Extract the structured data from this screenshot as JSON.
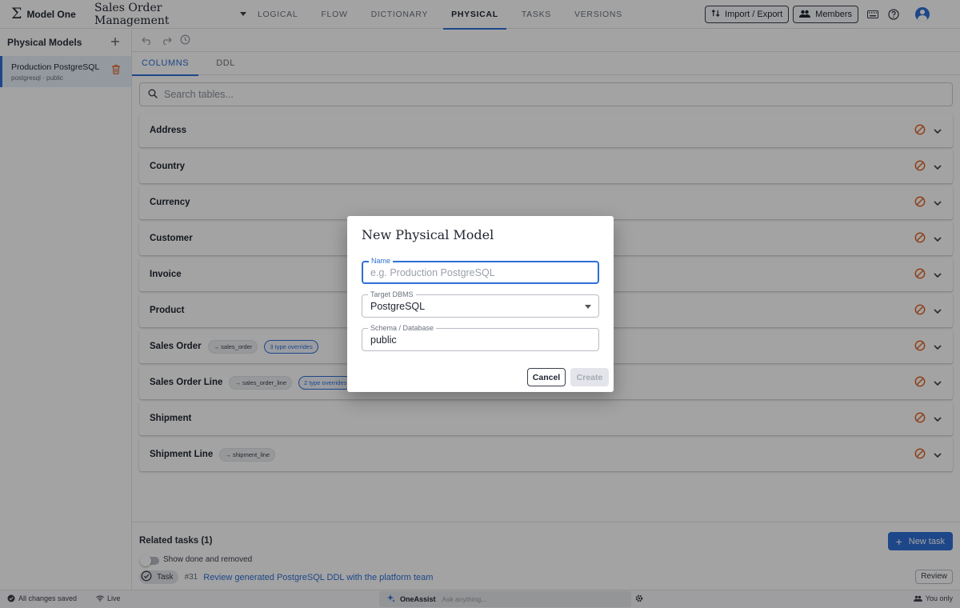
{
  "app": {
    "logo": "Σ",
    "name": "Model One",
    "project": "Sales Order Management"
  },
  "nav": {
    "tabs": [
      {
        "label": "LOGICAL"
      },
      {
        "label": "FLOW"
      },
      {
        "label": "DICTIONARY"
      },
      {
        "label": "PHYSICAL",
        "active": true
      },
      {
        "label": "TASKS"
      },
      {
        "label": "VERSIONS"
      }
    ]
  },
  "toolbar": {
    "import_export": "Import / Export",
    "members": "Members"
  },
  "sidebar": {
    "title": "Physical Models",
    "items": [
      {
        "title": "Production PostgreSQL",
        "subtitle": "postgresql · public"
      }
    ]
  },
  "subtabs": [
    {
      "label": "COLUMNS",
      "active": true
    },
    {
      "label": "DDL"
    }
  ],
  "search": {
    "placeholder": "Search tables..."
  },
  "tables": [
    {
      "name": "Address"
    },
    {
      "name": "Country"
    },
    {
      "name": "Currency"
    },
    {
      "name": "Customer"
    },
    {
      "name": "Invoice"
    },
    {
      "name": "Product"
    },
    {
      "name": "Sales Order",
      "mapping": "→ sales_order",
      "overrides": "3 type overrides"
    },
    {
      "name": "Sales Order Line",
      "mapping": "→ sales_order_line",
      "overrides": "2 type overrides"
    },
    {
      "name": "Shipment"
    },
    {
      "name": "Shipment Line",
      "mapping": "→ shipment_line"
    }
  ],
  "related": {
    "title": "Related tasks (1)",
    "new_task": "New task",
    "toggle_label": "Show done and removed",
    "task": {
      "type": "Task",
      "number": "#31",
      "title": "Review generated PostgreSQL DDL with the platform team",
      "action": "Review"
    }
  },
  "status": {
    "saved": "All changes saved",
    "live": "Live",
    "assist_name": "OneAssist",
    "assist_placeholder": "Ask anything...",
    "visibility": "You only"
  },
  "modal": {
    "title": "New Physical Model",
    "name_label": "Name",
    "name_placeholder": "e.g. Production PostgreSQL",
    "dbms_label": "Target DBMS",
    "dbms_value": "PostgreSQL",
    "schema_label": "Schema / Database",
    "schema_value": "public",
    "cancel": "Cancel",
    "create": "Create"
  },
  "colors": {
    "accent": "#2f6fd6",
    "warning": "#e0672a",
    "danger": "#e0672a"
  }
}
